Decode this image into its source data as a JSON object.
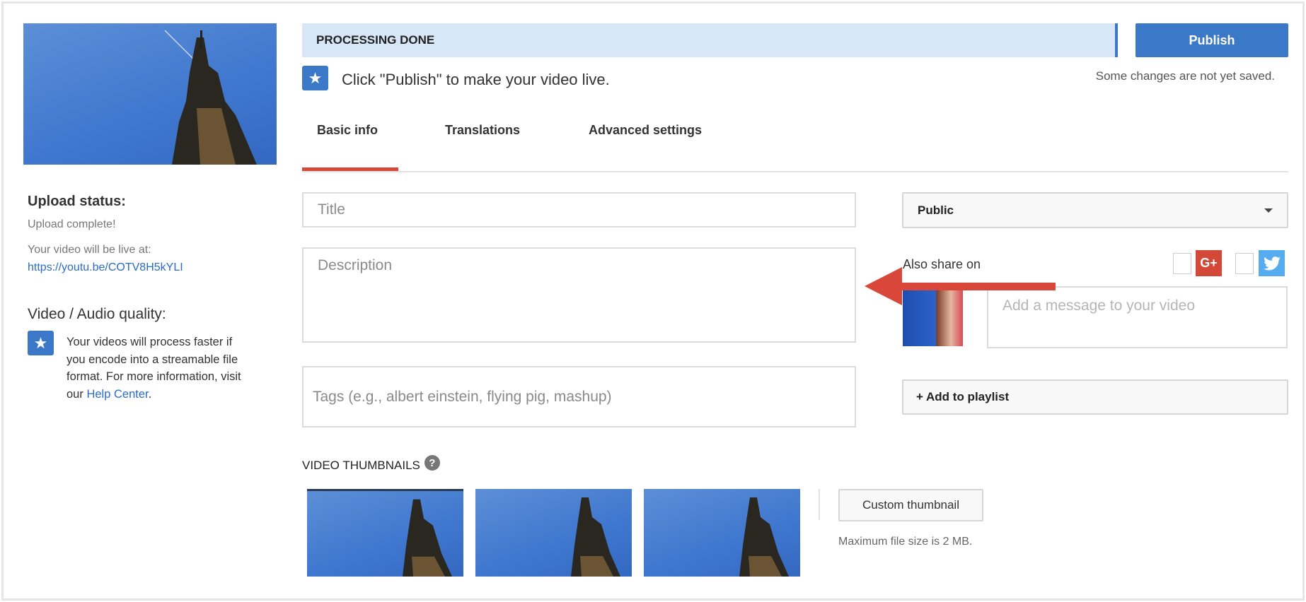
{
  "status_bar": {
    "label": "PROCESSING DONE"
  },
  "publish": {
    "label": "Publish",
    "hint": "Click \"Publish\" to make your video live.",
    "unsaved": "Some changes are not yet saved."
  },
  "tabs": [
    {
      "label": "Basic info",
      "active": true
    },
    {
      "label": "Translations"
    },
    {
      "label": "Advanced settings"
    }
  ],
  "sidebar": {
    "upload_status_title": "Upload status:",
    "upload_status": "Upload complete!",
    "live_at_label": "Your video will be live at:",
    "live_url": "https://youtu.be/COTV8H5kYLI",
    "quality_title": "Video / Audio quality:",
    "quality_text": "Your videos will process faster if you encode into a streamable file format. For more information, visit our",
    "help_link": "Help Center",
    "help_suffix": "."
  },
  "form": {
    "title_placeholder": "Title",
    "description_placeholder": "Description",
    "tags_placeholder": "Tags (e.g., albert einstein, flying pig, mashup)",
    "privacy": "Public",
    "share_label": "Also share on",
    "message_placeholder": "Add a message to your video",
    "playlist_label": "+ Add to playlist",
    "gplus_label": "G+"
  },
  "thumbnails": {
    "title": "VIDEO THUMBNAILS",
    "custom_label": "Custom thumbnail",
    "max_size": "Maximum file size is 2 MB."
  },
  "colors": {
    "accent": "#3b78c8",
    "status_bg": "#d7e7f7",
    "tab_active": "#d9473b",
    "arrow": "#d9473b",
    "gplus": "#d34836",
    "twitter": "#55acee"
  }
}
